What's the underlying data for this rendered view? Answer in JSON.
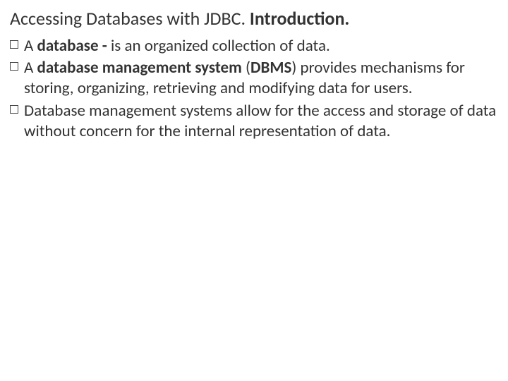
{
  "title": {
    "plain": "Accessing Databases with JDBC. ",
    "bold": "Introduction."
  },
  "bullets": [
    {
      "pre": "A ",
      "b1": "database  - ",
      "post": "is an organized collection of data."
    },
    {
      "pre": "A ",
      "b1": "database management system ",
      "mid": "(",
      "b2": "DBMS",
      "post": ") provides mechanisms for storing, organizing, retrieving and modifying data for users."
    },
    {
      "pre": "Database management systems allow for the access and storage of data without concern for the internal representation of data."
    }
  ]
}
